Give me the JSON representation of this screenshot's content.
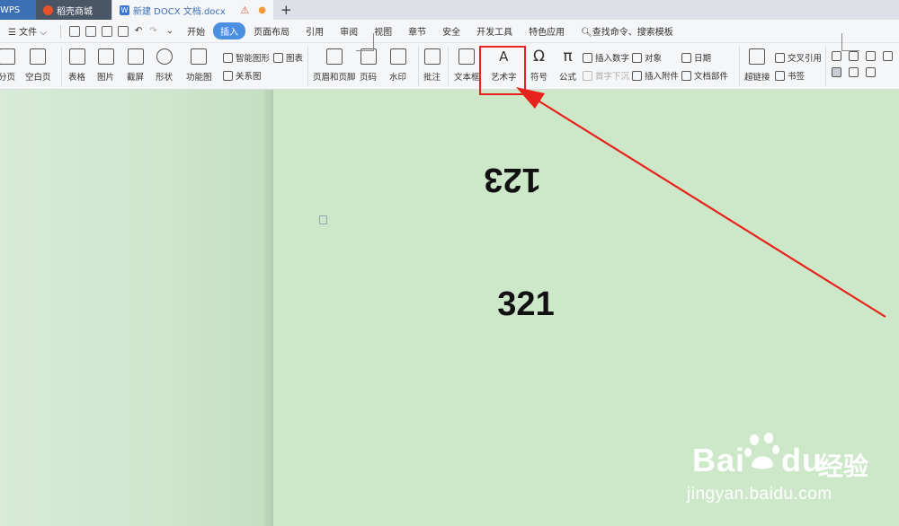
{
  "tabs": [
    {
      "label": "WPS"
    },
    {
      "label": "稻壳商城"
    },
    {
      "label": "新建 DOCX 文档.docx"
    }
  ],
  "menu": {
    "file_label": "文件",
    "items": [
      "开始",
      "插入",
      "页面布局",
      "引用",
      "审阅",
      "视图",
      "章节",
      "安全",
      "开发工具",
      "特色应用"
    ],
    "active": "插入",
    "search_label": "查找命令、搜索模板"
  },
  "ribbon": {
    "page_break": "分页",
    "blank_page": "空白页",
    "table": "表格",
    "picture": "图片",
    "screenshot": "截屏",
    "shape": "形状",
    "function_chart": "功能图",
    "smart_shape": "智能图形",
    "chart": "图表",
    "relation_chart": "关系图",
    "header_footer": "页眉和页脚",
    "page_number": "页码",
    "watermark": "水印",
    "comment": "批注",
    "text_box": "文本框",
    "word_art": "艺术字",
    "symbol": "符号",
    "formula": "公式",
    "insert_number": "插入数字",
    "drop_cap": "首字下沉",
    "object": "对象",
    "insert_attachment": "插入附件",
    "date": "日期",
    "doc_parts": "文档部件",
    "hyperlink": "超链接",
    "cross_reference": "交叉引用",
    "bookmark": "书签"
  },
  "document": {
    "flipped_text": "123",
    "normal_text": "321"
  },
  "watermark": {
    "brand": "Bai",
    "brand_suffix": "du",
    "jingyan": "经验",
    "url": "jingyan.baidu.com"
  },
  "colors": {
    "accent": "#4b8fe0",
    "highlight": "#e8231e",
    "doc_bg": "#cce8c9"
  }
}
